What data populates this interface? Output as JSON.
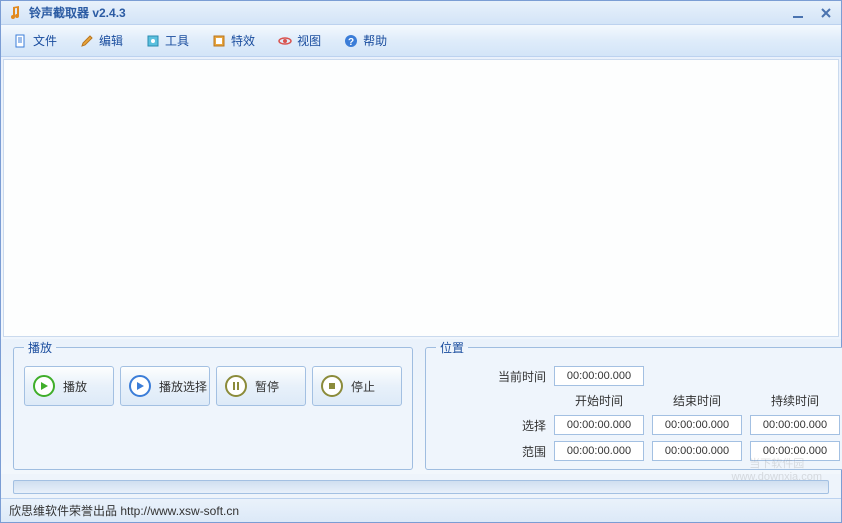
{
  "app": {
    "title": "铃声截取器 v2.4.3"
  },
  "menu": {
    "file": "文件",
    "edit": "编辑",
    "tools": "工具",
    "effects": "特效",
    "view": "视图",
    "help": "帮助"
  },
  "playback": {
    "legend": "播放",
    "play": "播放",
    "play_selection": "播放选择",
    "pause": "暂停",
    "stop": "停止"
  },
  "position": {
    "legend": "位置",
    "current_time_label": "当前时间",
    "current_time_value": "00:00:00.000",
    "headers": {
      "start": "开始时间",
      "end": "结束时间",
      "duration": "持续时间"
    },
    "rows": {
      "selection": {
        "label": "选择",
        "start": "00:00:00.000",
        "end": "00:00:00.000",
        "duration": "00:00:00.000"
      },
      "range": {
        "label": "范围",
        "start": "00:00:00.000",
        "end": "00:00:00.000",
        "duration": "00:00:00.000"
      }
    }
  },
  "statusbar": {
    "text": "欣思维软件荣誉出品 http://www.xsw-soft.cn"
  },
  "watermark": {
    "line1": "当下软件园",
    "line2": "www.downxia.com"
  },
  "colors": {
    "play_green": "#3fae2a",
    "pause_olive": "#8b8b3a",
    "stop_olive": "#8b8b3a"
  }
}
